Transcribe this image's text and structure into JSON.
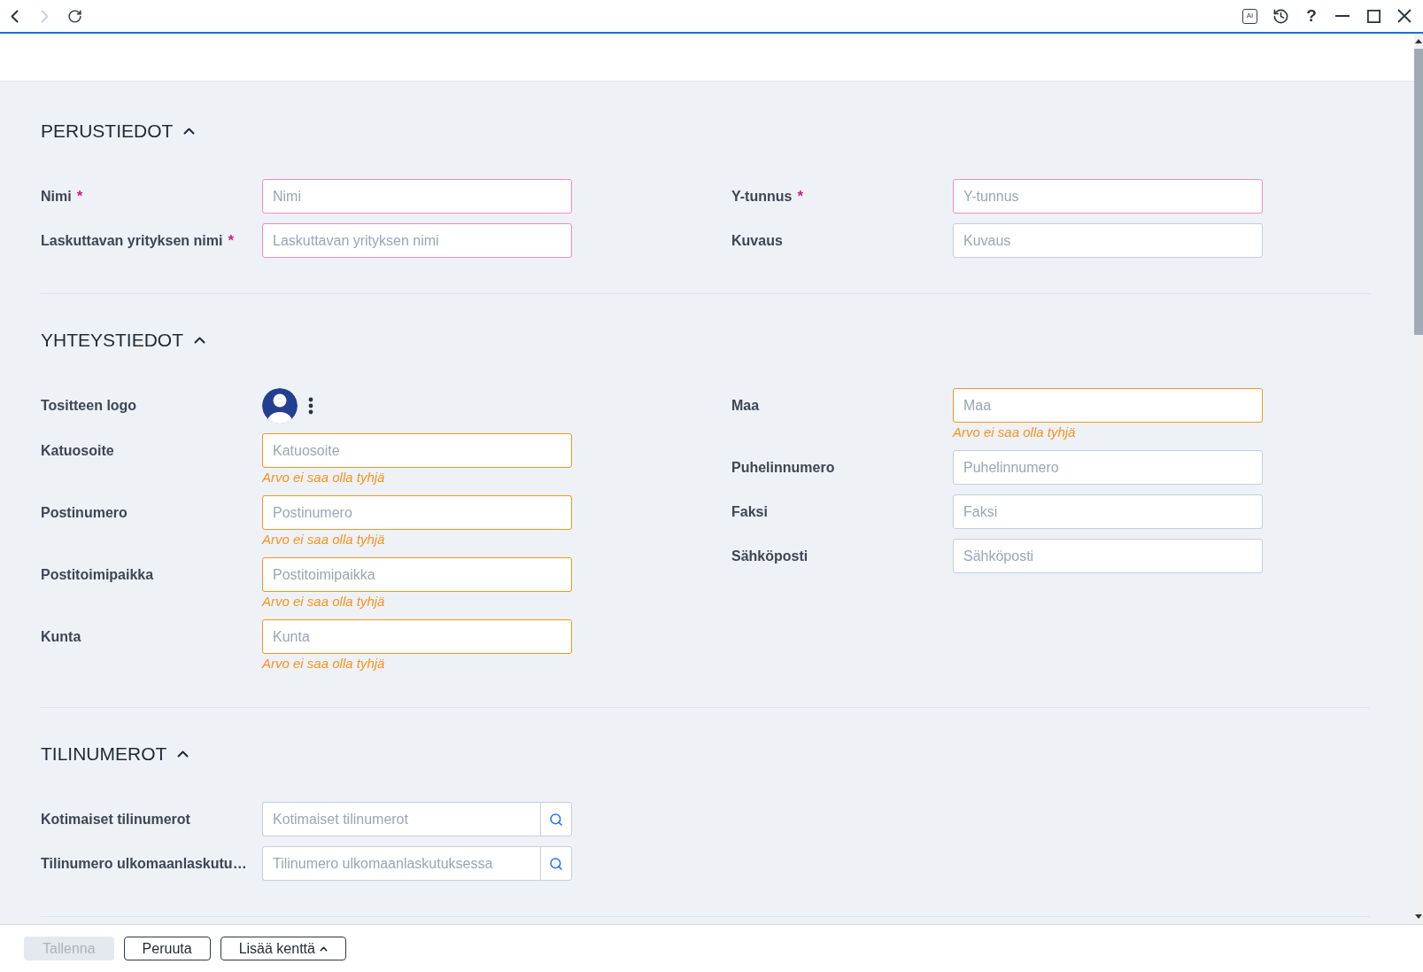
{
  "nav_buttons": [
    {
      "kind": "back",
      "disabled": false
    },
    {
      "kind": "forward",
      "disabled": true
    },
    {
      "kind": "refresh",
      "disabled": false
    }
  ],
  "window_controls": [
    {
      "kind": "ai",
      "label": "AI"
    },
    {
      "kind": "history"
    },
    {
      "kind": "help",
      "label": "?"
    },
    {
      "kind": "minimize"
    },
    {
      "kind": "maximize"
    },
    {
      "kind": "close"
    }
  ],
  "sections": [
    {
      "title": "PERUSTIEDOT",
      "expanded": true,
      "columns": [
        [
          {
            "kind": "text",
            "label": "Nimi",
            "required": true,
            "required_mark": "*",
            "invalid": false,
            "placeholder": "Nimi"
          },
          {
            "kind": "text",
            "label": "Laskuttavan yrityksen nimi",
            "required": true,
            "required_mark": "*",
            "invalid": false,
            "placeholder": "Laskuttavan yrityksen nimi"
          }
        ],
        [
          {
            "kind": "text",
            "label": "Y-tunnus",
            "required": true,
            "required_mark": "*",
            "invalid": false,
            "placeholder": "Y-tunnus"
          },
          {
            "kind": "text",
            "label": "Kuvaus",
            "required": false,
            "invalid": false,
            "placeholder": "Kuvaus"
          }
        ]
      ]
    },
    {
      "title": "YHTEYSTIEDOT",
      "expanded": true,
      "columns": [
        [
          {
            "kind": "logo",
            "label": "Tositteen logo"
          },
          {
            "kind": "text",
            "label": "Katuosoite",
            "required": false,
            "invalid": true,
            "placeholder": "Katuosoite",
            "error": "Arvo ei saa olla tyhjä"
          },
          {
            "kind": "text",
            "label": "Postinumero",
            "required": false,
            "invalid": true,
            "placeholder": "Postinumero",
            "error": "Arvo ei saa olla tyhjä"
          },
          {
            "kind": "text",
            "label": "Postitoimipaikka",
            "required": false,
            "invalid": true,
            "placeholder": "Postitoimipaikka",
            "error": "Arvo ei saa olla tyhjä"
          },
          {
            "kind": "text",
            "label": "Kunta",
            "required": false,
            "invalid": true,
            "placeholder": "Kunta",
            "error": "Arvo ei saa olla tyhjä"
          }
        ],
        [
          {
            "kind": "text",
            "label": "Maa",
            "required": false,
            "invalid": true,
            "placeholder": "Maa",
            "error": "Arvo ei saa olla tyhjä"
          },
          {
            "kind": "text",
            "label": "Puhelinnumero",
            "required": false,
            "invalid": false,
            "placeholder": "Puhelinnumero"
          },
          {
            "kind": "text",
            "label": "Faksi",
            "required": false,
            "invalid": false,
            "placeholder": "Faksi"
          },
          {
            "kind": "text",
            "label": "Sähköposti",
            "required": false,
            "invalid": false,
            "placeholder": "Sähköposti"
          }
        ]
      ]
    },
    {
      "title": "TILINUMEROT",
      "expanded": true,
      "columns": [
        [
          {
            "kind": "lookup",
            "label": "Kotimaiset tilinumerot",
            "required": false,
            "invalid": false,
            "placeholder": "Kotimaiset tilinumerot"
          },
          {
            "kind": "lookup",
            "label": "Tilinumero ulkomaanlaskutu…",
            "required": false,
            "invalid": false,
            "placeholder": "Tilinumero ulkomaanlaskutuksessa"
          }
        ]
      ]
    }
  ],
  "footer": {
    "buttons": [
      {
        "label": "Tallenna",
        "disabled": true,
        "menu": false
      },
      {
        "label": "Peruuta",
        "disabled": false,
        "menu": false
      },
      {
        "label": "Lisää kenttä",
        "disabled": false,
        "menu": true
      }
    ]
  }
}
